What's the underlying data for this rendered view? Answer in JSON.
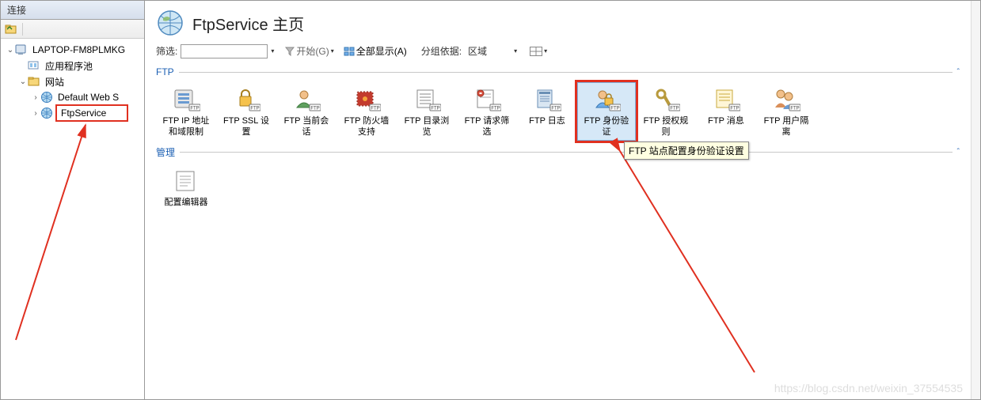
{
  "left": {
    "header": "连接",
    "tree": {
      "root": "LAPTOP-FM8PLMKG",
      "appPools": "应用程序池",
      "sites": "网站",
      "defaultSite": "Default Web S",
      "ftpService": "FtpService"
    }
  },
  "title": "FtpService 主页",
  "filterBar": {
    "filterLabel": "筛选:",
    "start": "开始(G)",
    "showAll": "全部显示(A)",
    "groupBy": "分组依据:",
    "groupValue": "区域"
  },
  "sections": {
    "ftp": "FTP",
    "management": "管理"
  },
  "ftpItems": [
    {
      "label": "FTP IP 地址\n和域限制"
    },
    {
      "label": "FTP SSL 设\n置"
    },
    {
      "label": "FTP 当前会\n话"
    },
    {
      "label": "FTP 防火墙\n支持"
    },
    {
      "label": "FTP 目录浏\n览"
    },
    {
      "label": "FTP 请求筛\n选"
    },
    {
      "label": "FTP 日志"
    },
    {
      "label": "FTP 身份验\n证"
    },
    {
      "label": "FTP 授权规\n则"
    },
    {
      "label": "FTP 消息"
    },
    {
      "label": "FTP 用户隔\n离"
    }
  ],
  "mgmtItems": [
    {
      "label": "配置编辑器"
    }
  ],
  "tooltip": "FTP 站点配置身份验证设置",
  "watermark": "https://blog.csdn.net/weixin_37554535",
  "ftpBadge": "FTP"
}
